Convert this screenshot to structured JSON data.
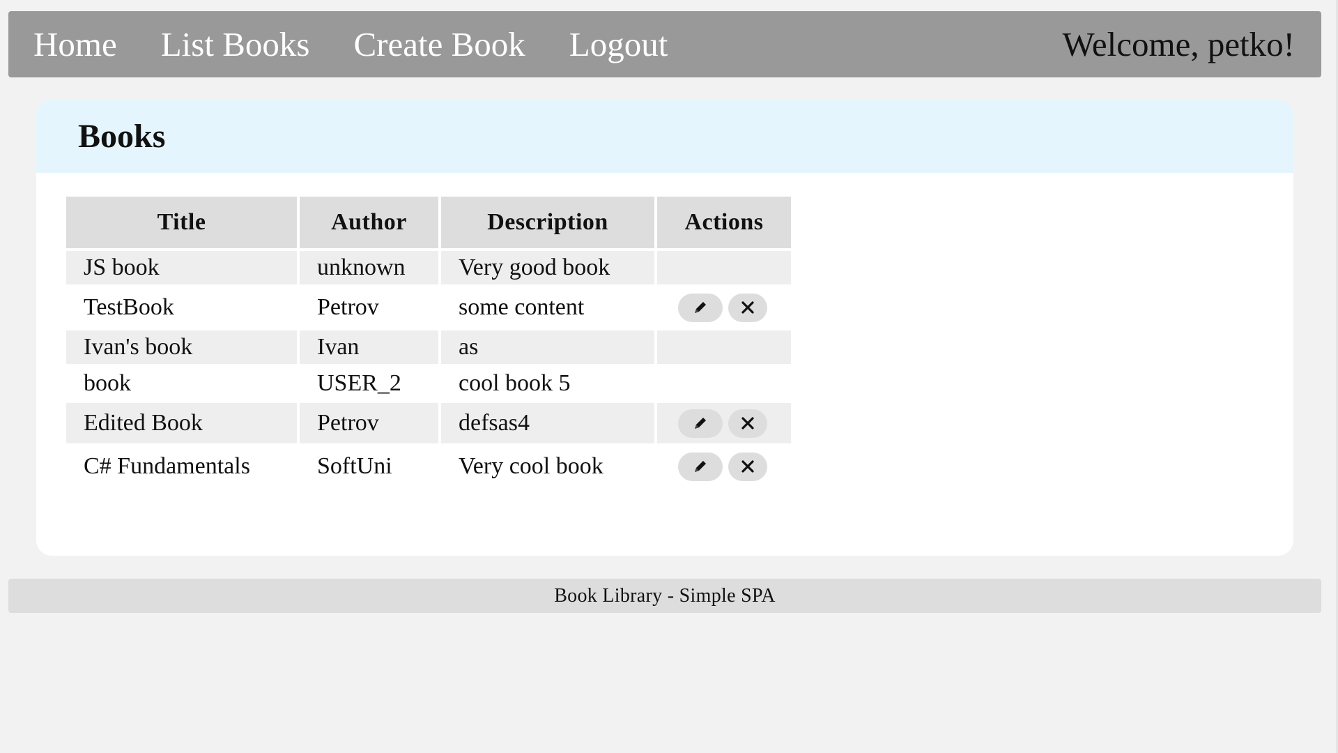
{
  "nav": {
    "links": [
      "Home",
      "List Books",
      "Create Book",
      "Logout"
    ],
    "welcome": "Welcome, petko!"
  },
  "main": {
    "title": "Books",
    "table": {
      "headers": [
        "Title",
        "Author",
        "Description",
        "Actions"
      ],
      "rows": [
        {
          "title": "JS book",
          "author": "unknown",
          "description": "Very good book",
          "has_actions": false
        },
        {
          "title": "TestBook",
          "author": "Petrov",
          "description": "some content",
          "has_actions": true
        },
        {
          "title": "Ivan's book",
          "author": "Ivan",
          "description": "as",
          "has_actions": false
        },
        {
          "title": "book",
          "author": "USER_2",
          "description": "cool book 5",
          "has_actions": false
        },
        {
          "title": "Edited Book",
          "author": "Petrov",
          "description": "defsas4",
          "has_actions": true
        },
        {
          "title": "C# Fundamentals",
          "author": "SoftUni",
          "description": "Very cool book",
          "has_actions": true
        }
      ],
      "action_icons": [
        "pencil-icon",
        "close-icon"
      ]
    }
  },
  "footer": {
    "text": "Book Library - Simple SPA"
  },
  "colors": {
    "navbar": "#999999",
    "panel_header": "#e5f5fd",
    "table_header": "#dddddd",
    "row_alt": "#eeeeee",
    "page_bg": "#f2f2f2"
  }
}
